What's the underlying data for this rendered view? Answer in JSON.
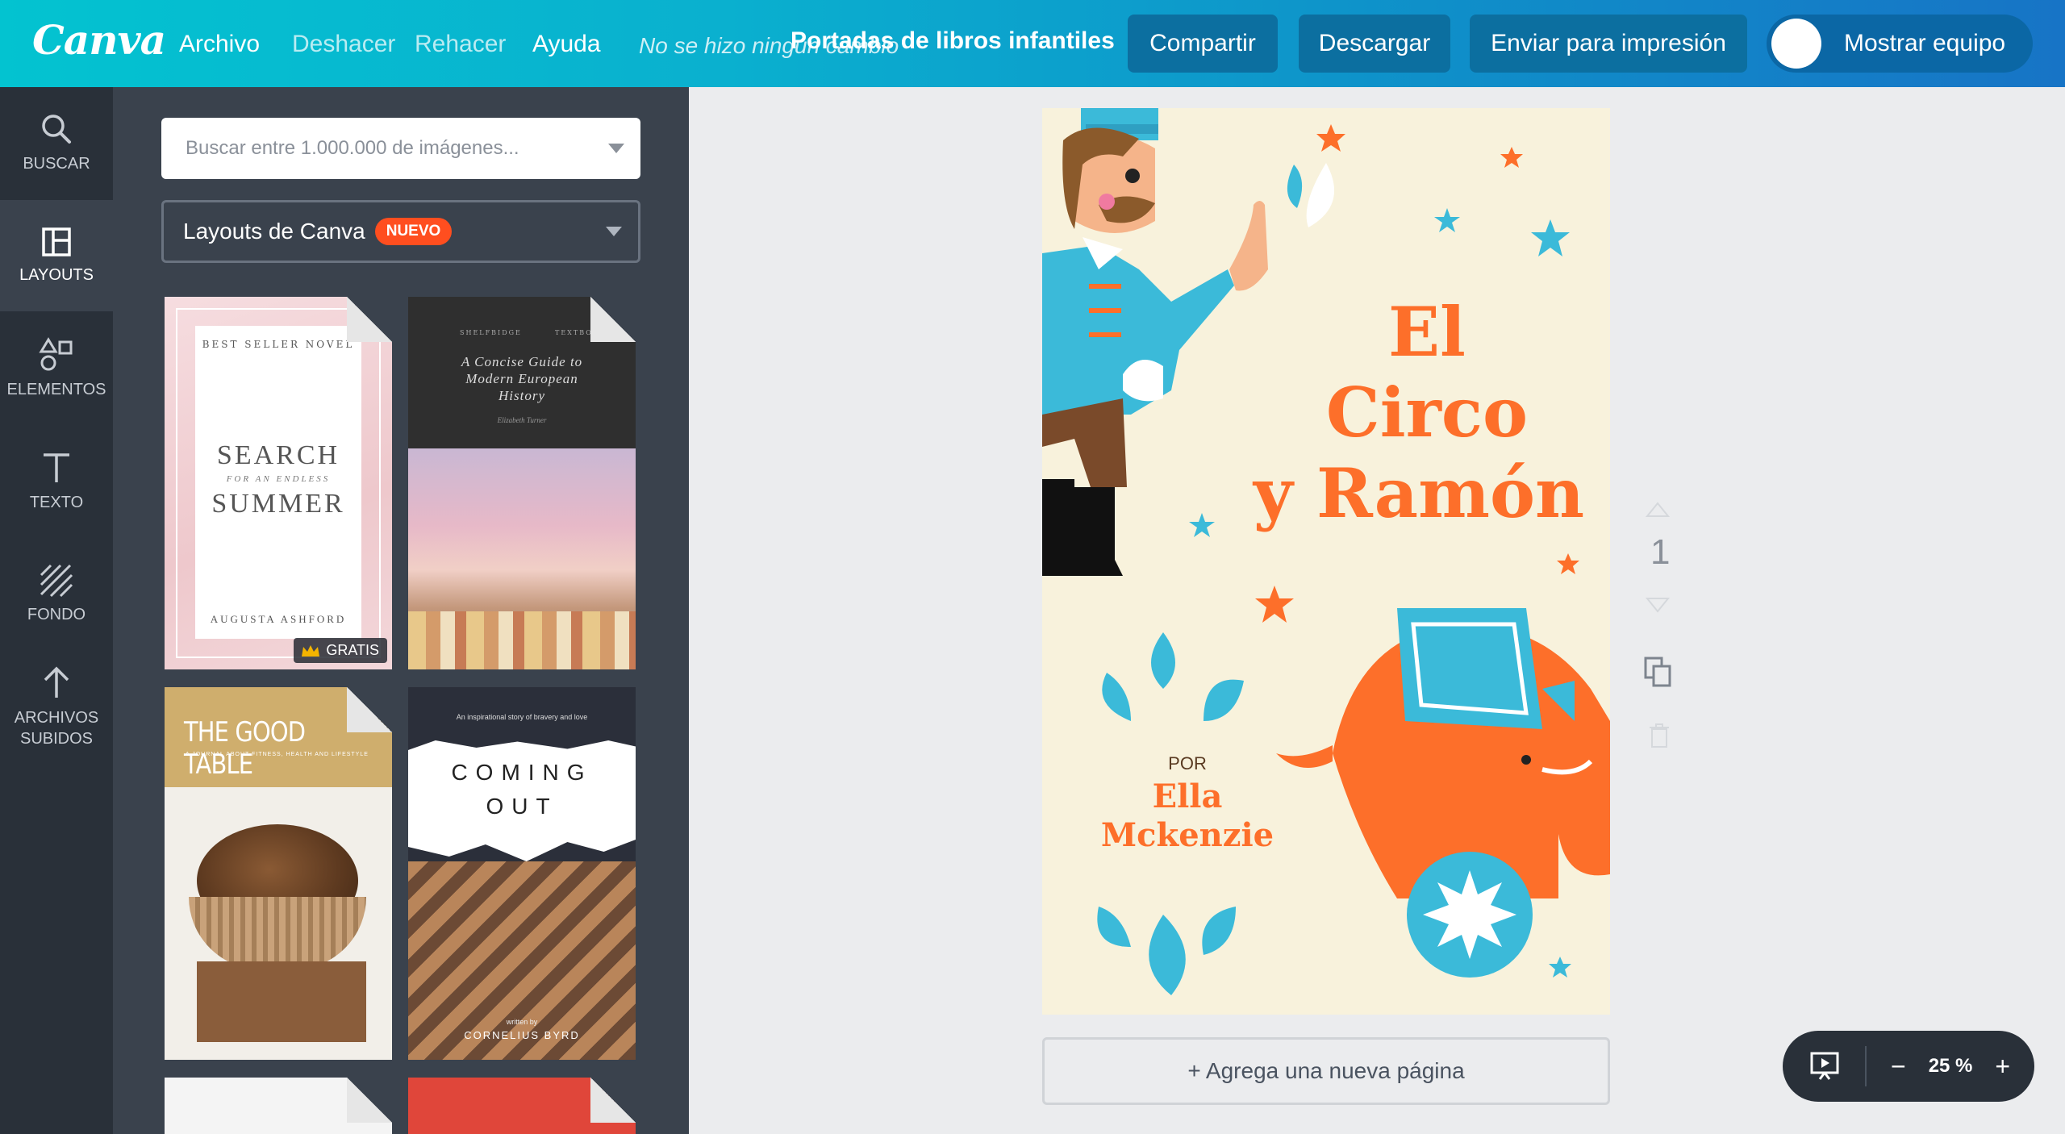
{
  "app": {
    "logo": "Canva",
    "menu": [
      "Archivo",
      "Deshacer",
      "Rehacer",
      "Ayuda"
    ],
    "saved_note": "No se hizo ningún cambio",
    "doc_title": "Portadas de libros infantiles",
    "buttons": {
      "share": "Compartir",
      "download": "Descargar",
      "print": "Enviar para impresión",
      "team": "Mostrar equipo"
    }
  },
  "rail": [
    {
      "label": "BUSCAR",
      "icon": "search-icon"
    },
    {
      "label": "LAYOUTS",
      "icon": "layouts-icon"
    },
    {
      "label": "ELEMENTOS",
      "icon": "elements-icon"
    },
    {
      "label": "TEXTO",
      "icon": "text-icon"
    },
    {
      "label": "FONDO",
      "icon": "background-icon"
    },
    {
      "label": "ARCHIVOS",
      "label2": "SUBIDOS",
      "icon": "upload-icon"
    }
  ],
  "panel": {
    "search_placeholder": "Buscar entre 1.000.000 de imágenes...",
    "layout_select": "Layouts de Canva",
    "badge": "NUEVO",
    "thumbs": [
      {
        "top_text": "BEST SELLER NOVEL",
        "title1": "SEARCH",
        "sub": "FOR AN ENDLESS",
        "title2": "SUMMER",
        "author": "AUGUSTA ASHFORD",
        "badge": "GRATIS"
      },
      {
        "pub_left": "SHELFBIDGE",
        "pub_right": "TEXTBOOKS",
        "title": "A Concise Guide to Modern European History",
        "author": "Elizabeth Turner"
      },
      {
        "title": "THE GOOD TABLE",
        "sub": "A JOURNAL ABOUT FITNESS, HEALTH AND LIFESTYLE"
      },
      {
        "top": "An inspirational story of bravery and love",
        "title1": "COMING",
        "title2": "OUT",
        "written": "written by",
        "author": "CORNELIUS BYRD"
      }
    ]
  },
  "cover": {
    "title1": "El",
    "title2": "Circo",
    "title3": "y Ramón",
    "por": "POR",
    "author1": "Ella",
    "author2": "Mckenzie"
  },
  "canvas": {
    "add_page": "+ Agrega una nueva página",
    "page_number": "1"
  },
  "zoom": {
    "value": "25 %",
    "minus": "−",
    "plus": "+"
  },
  "colors": {
    "orange": "#fd6f2a",
    "blue": "#3bbad9",
    "cream": "#f8f2dc",
    "panel": "#3a424d",
    "rail": "#293039"
  }
}
